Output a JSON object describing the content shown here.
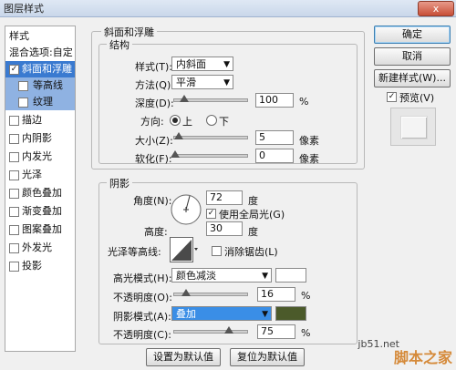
{
  "window": {
    "title": "图层样式",
    "close": "x"
  },
  "left_panel": {
    "header": "样式",
    "blend": "混合选项:自定",
    "items": [
      {
        "label": "斜面和浮雕",
        "checked": true,
        "state": "selected"
      },
      {
        "label": "等高线",
        "checked": false,
        "state": "sub"
      },
      {
        "label": "纹理",
        "checked": false,
        "state": "sub"
      },
      {
        "label": "描边",
        "checked": false
      },
      {
        "label": "内阴影",
        "checked": false
      },
      {
        "label": "内发光",
        "checked": false
      },
      {
        "label": "光泽",
        "checked": false
      },
      {
        "label": "颜色叠加",
        "checked": false
      },
      {
        "label": "渐变叠加",
        "checked": false
      },
      {
        "label": "图案叠加",
        "checked": false
      },
      {
        "label": "外发光",
        "checked": false
      },
      {
        "label": "投影",
        "checked": false
      }
    ]
  },
  "bevel": {
    "title": "斜面和浮雕",
    "structure_title": "结构",
    "style_label": "样式(T):",
    "style_value": "内斜面",
    "technique_label": "方法(Q):",
    "technique_value": "平滑",
    "depth_label": "深度(D):",
    "depth_value": "100",
    "depth_unit": "%",
    "direction_label": "方向:",
    "dir_up": "上",
    "dir_down": "下",
    "size_label": "大小(Z):",
    "size_value": "5",
    "size_unit": "像素",
    "soften_label": "软化(F):",
    "soften_value": "0",
    "soften_unit": "像素"
  },
  "shading": {
    "title": "阴影",
    "angle_label": "角度(N):",
    "angle_value": "72",
    "angle_unit": "度",
    "global_light": "使用全局光(G)",
    "altitude_label": "高度:",
    "altitude_value": "30",
    "altitude_unit": "度",
    "gloss_label": "光泽等高线:",
    "antialias": "消除锯齿(L)",
    "highlight_label": "高光模式(H):",
    "highlight_value": "颜色减淡",
    "highlight_color": "#ffffff",
    "hl_opacity_label": "不透明度(O):",
    "hl_opacity_value": "16",
    "hl_opacity_unit": "%",
    "shadow_label": "阴影模式(A):",
    "shadow_value": "叠加",
    "shadow_color": "#4b5a2a",
    "sh_opacity_label": "不透明度(C):",
    "sh_opacity_value": "75",
    "sh_opacity_unit": "%"
  },
  "footer": {
    "make_default": "设置为默认值",
    "reset_default": "复位为默认值"
  },
  "right": {
    "ok": "确定",
    "cancel": "取消",
    "new_style": "新建样式(W)...",
    "preview": "预览(V)"
  },
  "watermark": {
    "url": "jb51.net",
    "brand": "脚本之家"
  }
}
